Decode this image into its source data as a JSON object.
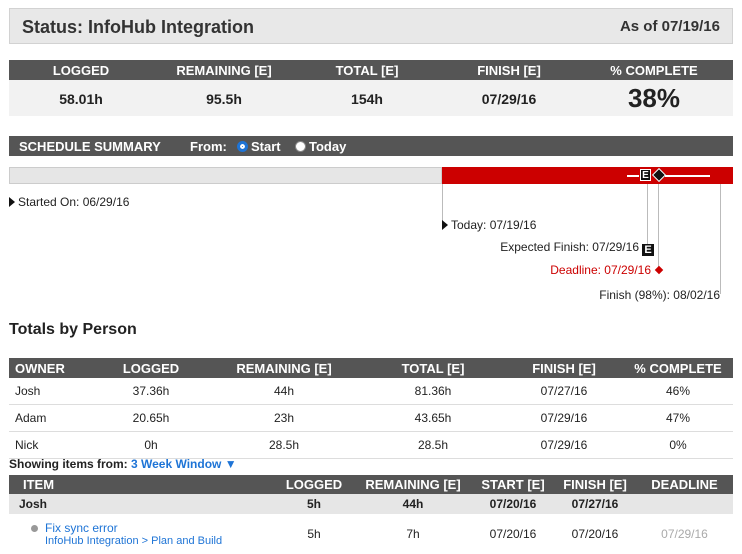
{
  "header": {
    "title": "Status: InfoHub Integration",
    "as_of": "As of 07/19/16"
  },
  "stats": {
    "labels": {
      "logged": "LOGGED",
      "remaining": "REMAINING [E]",
      "total": "TOTAL [E]",
      "finish": "FINISH [E]",
      "complete": "% COMPLETE"
    },
    "values": {
      "logged": "58.01h",
      "remaining": "95.5h",
      "total": "154h",
      "finish": "07/29/16",
      "complete": "38%"
    }
  },
  "schedule": {
    "title": "SCHEDULE SUMMARY",
    "from_label": "From:",
    "option_start": "Start",
    "option_today": "Today",
    "selected": "Start",
    "progress_fraction": 0.6,
    "colors": {
      "elapsed": "#e6e6e6",
      "remaining": "#cc0000"
    },
    "markers": {
      "started": "Started On: 06/29/16",
      "today": "Today: 07/19/16",
      "expected": "Expected Finish: 07/29/16",
      "expected_icon": "E",
      "deadline": "Deadline: 07/29/16",
      "finish": "Finish (98%): 08/02/16"
    }
  },
  "totals": {
    "title": "Totals by Person",
    "headers": {
      "owner": "OWNER",
      "logged": "LOGGED",
      "remaining": "REMAINING [E]",
      "total": "TOTAL [E]",
      "finish": "FINISH [E]",
      "complete": "% COMPLETE"
    },
    "rows": [
      {
        "owner": "Josh",
        "logged": "37.36h",
        "remaining": "44h",
        "total": "81.36h",
        "finish": "07/27/16",
        "complete": "46%"
      },
      {
        "owner": "Adam",
        "logged": "20.65h",
        "remaining": "23h",
        "total": "43.65h",
        "finish": "07/29/16",
        "complete": "47%"
      },
      {
        "owner": "Nick",
        "logged": "0h",
        "remaining": "28.5h",
        "total": "28.5h",
        "finish": "07/29/16",
        "complete": "0%"
      }
    ]
  },
  "items": {
    "showing_label": "Showing items from:",
    "window": "3 Week Window",
    "window_arrow": "▼",
    "headers": {
      "item": "ITEM",
      "logged": "LOGGED",
      "remaining": "REMAINING [E]",
      "start": "START [E]",
      "finish": "FINISH [E]",
      "deadline": "DEADLINE"
    },
    "group": {
      "name": "Josh",
      "logged": "5h",
      "remaining": "44h",
      "start": "07/20/16",
      "finish": "07/27/16",
      "deadline": ""
    },
    "rows": [
      {
        "name": "Fix sync error",
        "project": "InfoHub Integration",
        "sep": ">",
        "phase": "Plan and Build",
        "logged": "5h",
        "remaining": "7h",
        "start": "07/20/16",
        "finish": "07/20/16",
        "deadline": "07/29/16"
      }
    ]
  }
}
